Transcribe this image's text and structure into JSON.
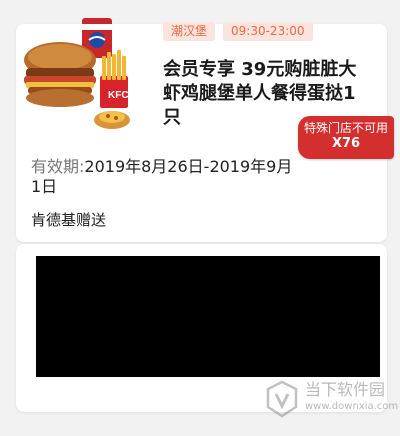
{
  "coupon": {
    "tags": [
      "潮汉堡",
      "09:30-23:00"
    ],
    "title": "会员专享 39元购脏脏大虾鸡腿堡单人餐得蛋挞1只",
    "store_flag": {
      "line1": "特殊门店不可用",
      "line2": "X76"
    },
    "validity_label": "有效期:",
    "validity_value": "2019年8月26日-2019年9月1日",
    "giver": "肯德基赠送",
    "image_icon": "burger-meal-image"
  },
  "redeem_code": {
    "hidden": true
  },
  "watermark": {
    "text1": "当下软件园",
    "text2": "www.downxia.com",
    "icon": "watermark-logo-icon"
  },
  "colors": {
    "tag_bg": "#fbe4dc",
    "tag_text": "#e8694a",
    "flag_bg": "#d32f2f",
    "page_bg": "#f2f2f2"
  }
}
